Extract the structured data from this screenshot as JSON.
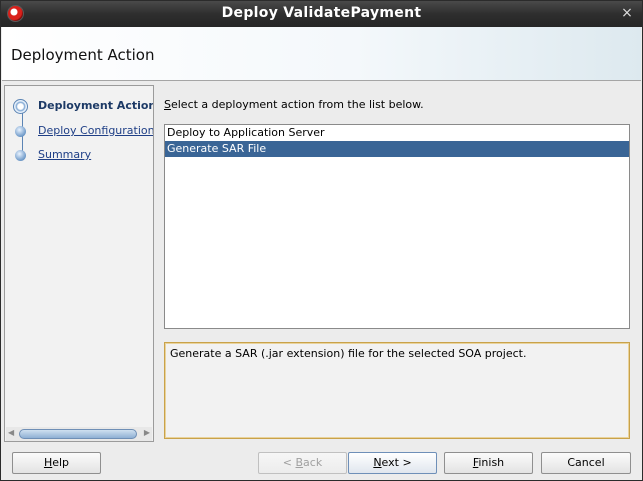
{
  "window": {
    "title": "Deploy ValidatePayment",
    "close_glyph": "×"
  },
  "header": {
    "title": "Deployment Action"
  },
  "nav": {
    "items": [
      {
        "label": "Deployment Action",
        "state": "current"
      },
      {
        "label": "Deploy Configuration",
        "state": "link"
      },
      {
        "label": "Summary",
        "state": "link"
      }
    ],
    "scroll_left": "◀",
    "scroll_right": "▶"
  },
  "main": {
    "prompt_mnemonic": "S",
    "prompt_rest": "elect a deployment action from the list below.",
    "actions": [
      {
        "label": "Deploy to Application Server",
        "selected": false
      },
      {
        "label": "Generate SAR File",
        "selected": true
      }
    ],
    "description": "Generate a SAR (.jar extension) file for the selected SOA project."
  },
  "buttons": {
    "help": {
      "mnemonic": "H",
      "rest": "elp"
    },
    "back": {
      "pre": "< ",
      "mnemonic": "B",
      "rest": "ack"
    },
    "next": {
      "mnemonic": "N",
      "rest": "ext >"
    },
    "finish": {
      "mnemonic": "F",
      "rest": "inish"
    },
    "cancel": {
      "label": "Cancel"
    }
  },
  "icons": {
    "app": "oracle-jdeveloper-icon",
    "close": "close-icon",
    "nav_node": "train-stop-icon"
  },
  "colors": {
    "selection": "#3a6596",
    "link": "#1f3f86",
    "description_border": "#c9a24a"
  }
}
